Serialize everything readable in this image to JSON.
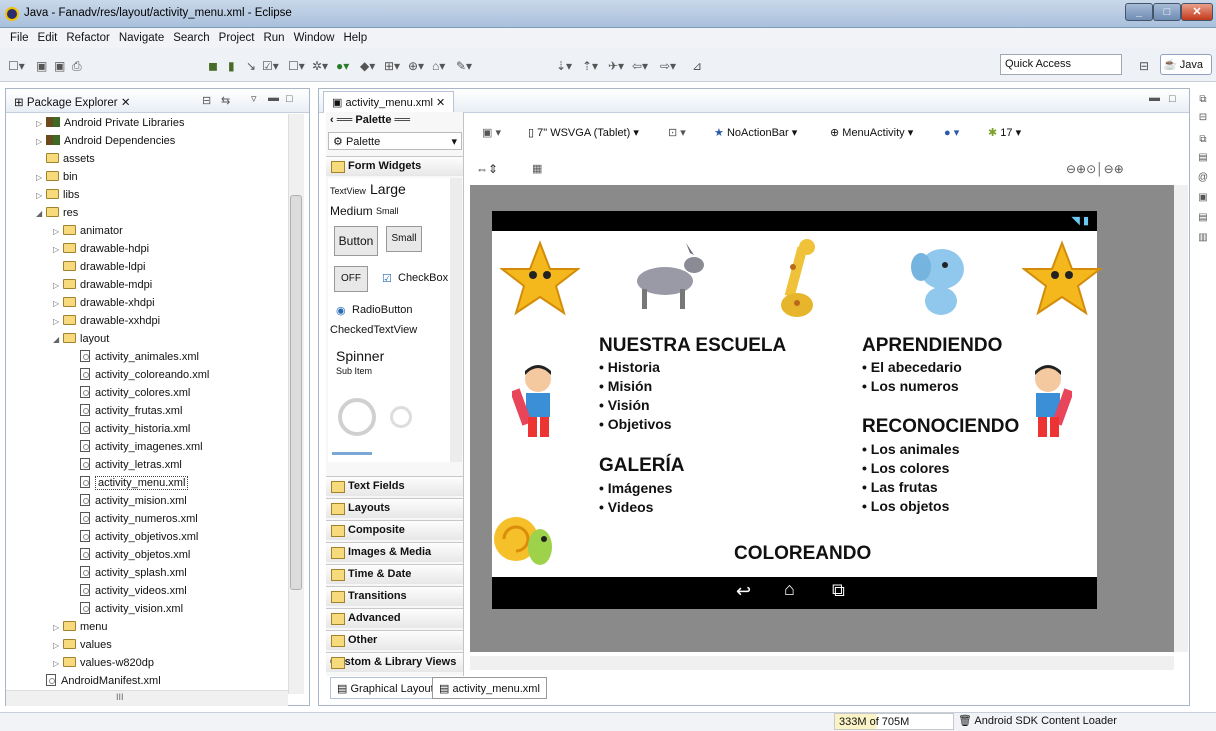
{
  "window": {
    "title": "Java - Fanadv/res/layout/activity_menu.xml - Eclipse"
  },
  "menu": [
    "File",
    "Edit",
    "Refactor",
    "Navigate",
    "Search",
    "Project",
    "Run",
    "Window",
    "Help"
  ],
  "toolbar": {
    "quick_access": "Quick Access",
    "perspective": "Java"
  },
  "package_explorer": {
    "title": "Package Explorer",
    "items": [
      {
        "label": "Android Private Libraries",
        "depth": 0,
        "icon": "library-icon",
        "toggle": "collapsed"
      },
      {
        "label": "Android Dependencies",
        "depth": 0,
        "icon": "library-icon",
        "toggle": "collapsed"
      },
      {
        "label": "assets",
        "depth": 0,
        "icon": "folder-icon",
        "toggle": "none"
      },
      {
        "label": "bin",
        "depth": 0,
        "icon": "folder-icon",
        "toggle": "collapsed"
      },
      {
        "label": "libs",
        "depth": 0,
        "icon": "folder-icon",
        "toggle": "collapsed"
      },
      {
        "label": "res",
        "depth": 0,
        "icon": "folder-icon",
        "toggle": "expanded"
      },
      {
        "label": "animator",
        "depth": 1,
        "icon": "folder-icon",
        "toggle": "collapsed"
      },
      {
        "label": "drawable-hdpi",
        "depth": 1,
        "icon": "folder-icon",
        "toggle": "collapsed"
      },
      {
        "label": "drawable-ldpi",
        "depth": 1,
        "icon": "folder-icon",
        "toggle": "none"
      },
      {
        "label": "drawable-mdpi",
        "depth": 1,
        "icon": "folder-icon",
        "toggle": "collapsed"
      },
      {
        "label": "drawable-xhdpi",
        "depth": 1,
        "icon": "folder-icon",
        "toggle": "collapsed"
      },
      {
        "label": "drawable-xxhdpi",
        "depth": 1,
        "icon": "folder-icon",
        "toggle": "collapsed"
      },
      {
        "label": "layout",
        "depth": 1,
        "icon": "folder-icon",
        "toggle": "expanded"
      },
      {
        "label": "activity_animales.xml",
        "depth": 2,
        "icon": "xml-file-icon",
        "toggle": "none"
      },
      {
        "label": "activity_coloreando.xml",
        "depth": 2,
        "icon": "xml-file-icon",
        "toggle": "none"
      },
      {
        "label": "activity_colores.xml",
        "depth": 2,
        "icon": "xml-file-icon",
        "toggle": "none"
      },
      {
        "label": "activity_frutas.xml",
        "depth": 2,
        "icon": "xml-file-icon",
        "toggle": "none"
      },
      {
        "label": "activity_historia.xml",
        "depth": 2,
        "icon": "xml-file-icon",
        "toggle": "none"
      },
      {
        "label": "activity_imagenes.xml",
        "depth": 2,
        "icon": "xml-file-icon",
        "toggle": "none"
      },
      {
        "label": "activity_letras.xml",
        "depth": 2,
        "icon": "xml-file-icon",
        "toggle": "none"
      },
      {
        "label": "activity_menu.xml",
        "depth": 2,
        "icon": "xml-file-icon",
        "toggle": "none",
        "selected": true
      },
      {
        "label": "activity_mision.xml",
        "depth": 2,
        "icon": "xml-file-icon",
        "toggle": "none"
      },
      {
        "label": "activity_numeros.xml",
        "depth": 2,
        "icon": "xml-file-icon",
        "toggle": "none"
      },
      {
        "label": "activity_objetivos.xml",
        "depth": 2,
        "icon": "xml-file-icon",
        "toggle": "none"
      },
      {
        "label": "activity_objetos.xml",
        "depth": 2,
        "icon": "xml-file-icon",
        "toggle": "none"
      },
      {
        "label": "activity_splash.xml",
        "depth": 2,
        "icon": "xml-file-icon",
        "toggle": "none"
      },
      {
        "label": "activity_videos.xml",
        "depth": 2,
        "icon": "xml-file-icon",
        "toggle": "none"
      },
      {
        "label": "activity_vision.xml",
        "depth": 2,
        "icon": "xml-file-icon",
        "toggle": "none"
      },
      {
        "label": "menu",
        "depth": 1,
        "icon": "folder-icon",
        "toggle": "collapsed"
      },
      {
        "label": "values",
        "depth": 1,
        "icon": "folder-icon",
        "toggle": "collapsed"
      },
      {
        "label": "values-w820dp",
        "depth": 1,
        "icon": "folder-icon",
        "toggle": "collapsed"
      },
      {
        "label": "AndroidManifest.xml",
        "depth": 0,
        "icon": "xml-file-icon",
        "toggle": "none"
      }
    ],
    "hscroll_grip": "III"
  },
  "editor": {
    "tab": "activity_menu.xml",
    "config": {
      "device": "7\" WSVGA (Tablet)",
      "theme": "NoActionBar",
      "activity": "MenuActivity",
      "api": "17"
    },
    "bottom_tabs": [
      "Graphical Layout",
      "activity_menu.xml"
    ]
  },
  "palette": {
    "header": "Palette",
    "dropdown": "Palette",
    "sections": [
      "Form Widgets",
      "Text Fields",
      "Layouts",
      "Composite",
      "Images & Media",
      "Time & Date",
      "Transitions",
      "Advanced",
      "Other",
      "Custom & Library Views"
    ],
    "widgets": {
      "textview": "TextView",
      "large": "Large",
      "medium": "Medium",
      "small": "Small",
      "button": "Button",
      "small_button": "Small",
      "off": "OFF",
      "checkbox": "CheckBox",
      "radio": "RadioButton",
      "checked": "CheckedTextView",
      "spinner": "Spinner",
      "subitem": "Sub Item"
    }
  },
  "device_screen": {
    "col1_title": "NUESTRA ESCUELA",
    "col1_items": [
      "Historia",
      "Misión",
      "Visión",
      "Objetivos"
    ],
    "gallery_title": "GALERÍA",
    "gallery_items": [
      "Imágenes",
      "Videos"
    ],
    "col2_title": "APRENDIENDO",
    "col2_items": [
      "El abecedario",
      "Los numeros"
    ],
    "recon_title": "RECONOCIENDO",
    "recon_items": [
      "Los animales",
      "Los colores",
      "Las frutas",
      "Los objetos"
    ],
    "bottom_title": "COLOREANDO"
  },
  "status": {
    "heap": "333M of 705M",
    "loader": "Android SDK Content Loader"
  }
}
